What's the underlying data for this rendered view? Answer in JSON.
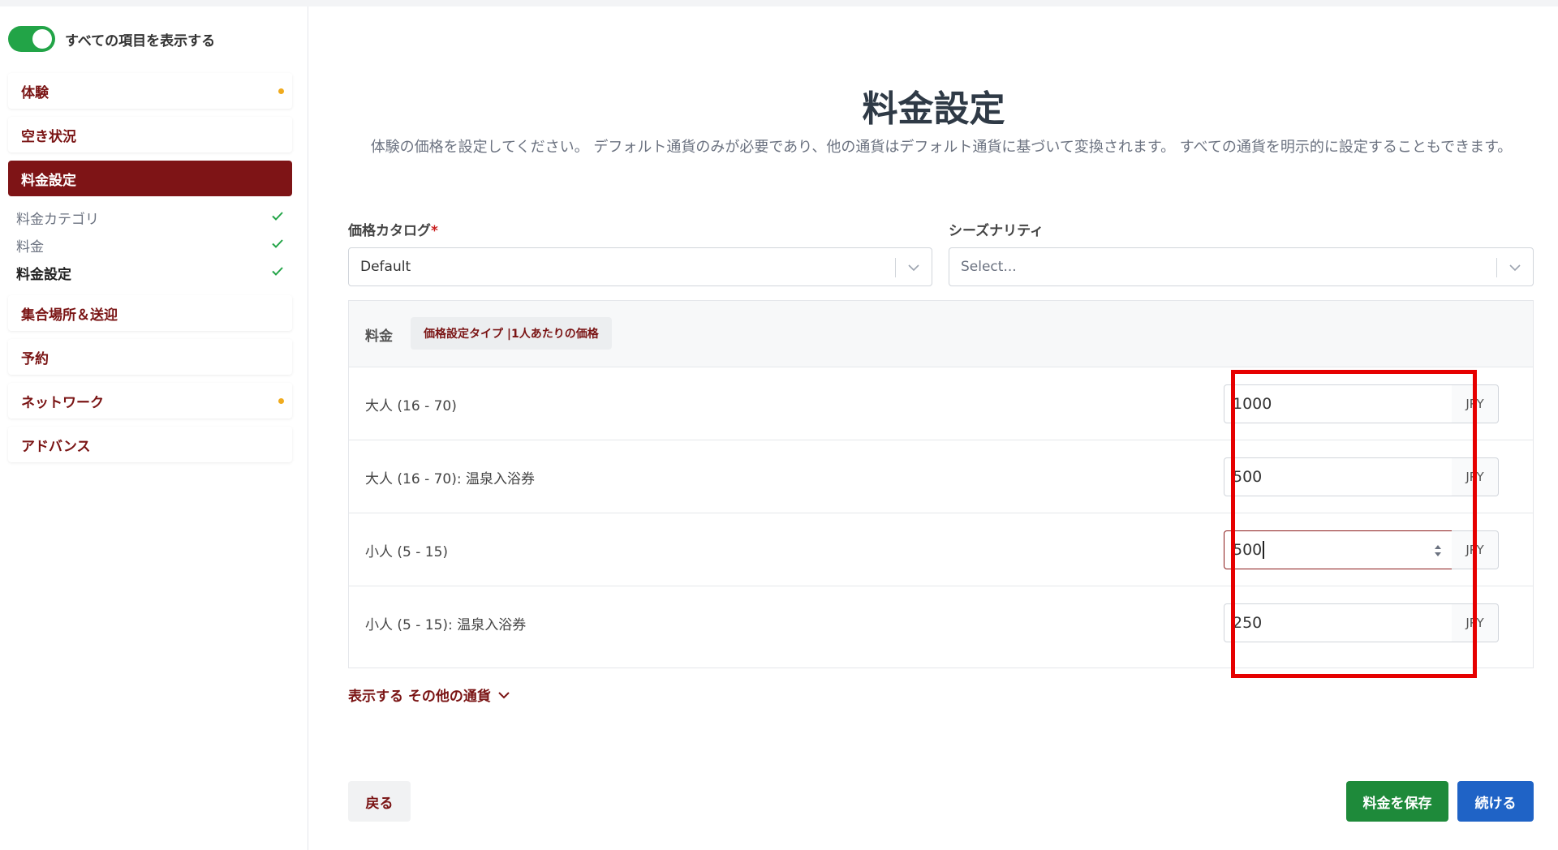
{
  "sidebar": {
    "toggle_label": "すべての項目を表示する",
    "items": [
      {
        "label": "体験",
        "dot": true
      },
      {
        "label": "空き状況",
        "dot": false
      },
      {
        "label": "料金設定",
        "dot": false
      },
      {
        "label": "集合場所＆送迎",
        "dot": false
      },
      {
        "label": "予約",
        "dot": false
      },
      {
        "label": "ネットワーク",
        "dot": true
      },
      {
        "label": "アドバンス",
        "dot": false
      }
    ],
    "subitems": [
      {
        "label": "料金カテゴリ"
      },
      {
        "label": "料金"
      },
      {
        "label": "料金設定"
      }
    ]
  },
  "main": {
    "title": "料金設定",
    "description": "体験の価格を設定してください。 デフォルト通貨のみが必要であり、他の通貨はデフォルト通貨に基づいて変換されます。 すべての通貨を明示的に設定することもできます。",
    "catalog": {
      "label": "価格カタログ",
      "required": "*",
      "value": "Default"
    },
    "seasonality": {
      "label": "シーズナリティ",
      "placeholder": "Select..."
    },
    "table": {
      "header_label": "料金",
      "badge": "価格設定タイプ |1人あたりの価格",
      "rows": [
        {
          "label": "大人 (16 - 70)",
          "value": "1000",
          "currency": "JPY"
        },
        {
          "label": "大人 (16 - 70): 温泉入浴券",
          "value": "500",
          "currency": "JPY"
        },
        {
          "label": "小人 (5 - 15)",
          "value": "500",
          "currency": "JPY"
        },
        {
          "label": "小人 (5 - 15): 温泉入浴券",
          "value": "250",
          "currency": "JPY"
        }
      ]
    },
    "more_currencies": "表示する その他の通貨",
    "buttons": {
      "back": "戻る",
      "save": "料金を保存",
      "next": "続ける"
    }
  },
  "colors": {
    "brand": "#7e1416",
    "toggle_on": "#22a447",
    "save": "#1e8a3a",
    "next": "#1f63c6",
    "highlight": "#e60000",
    "dot": "#f0ab1e"
  }
}
